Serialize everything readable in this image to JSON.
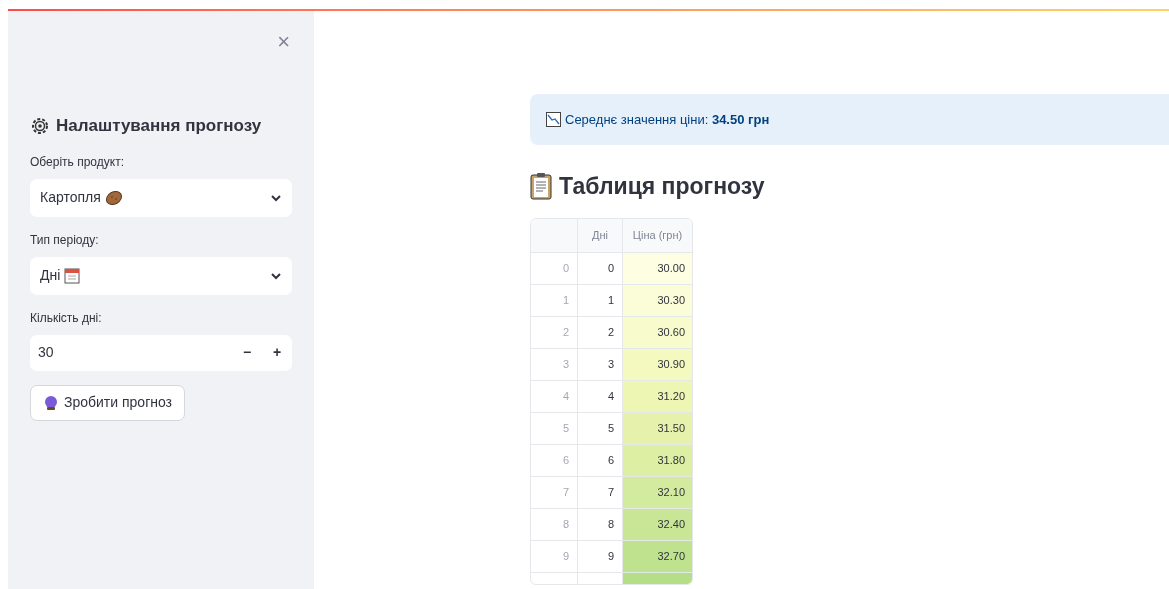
{
  "sidebar": {
    "close_label": "×",
    "title": "Налаштування прогнозу",
    "fields": [
      {
        "kind": "select",
        "label": "Оберіть продукт:",
        "value": "Картопля",
        "icon": {
          "kind": "potato"
        }
      },
      {
        "kind": "select",
        "label": "Тип періоду:",
        "value": "Дні",
        "icon": {
          "kind": "calendar"
        }
      },
      {
        "kind": "number",
        "label": "Кількість дні:",
        "value": "30",
        "minus": "−",
        "plus": "+"
      }
    ],
    "button": "Зробити прогноз"
  },
  "alert": {
    "text": "Середнє значення ціни: **34.50 грн**"
  },
  "table_title": "Таблиця прогнозу",
  "table": {
    "columns": [
      "Дні",
      "Ціна (грн)"
    ],
    "rows": [
      {
        "index": "0",
        "days": "0",
        "price": "30.00",
        "color": "#fefee3"
      },
      {
        "index": "1",
        "days": "1",
        "price": "30.30",
        "color": "#fbfcd8"
      },
      {
        "index": "2",
        "days": "2",
        "price": "30.60",
        "color": "#f8fbcc"
      },
      {
        "index": "3",
        "days": "3",
        "price": "30.90",
        "color": "#f4f9bf"
      },
      {
        "index": "4",
        "days": "4",
        "price": "31.20",
        "color": "#eef6b3"
      },
      {
        "index": "5",
        "days": "5",
        "price": "31.50",
        "color": "#e6f2ab"
      },
      {
        "index": "6",
        "days": "6",
        "price": "31.80",
        "color": "#dcefa3"
      },
      {
        "index": "7",
        "days": "7",
        "price": "32.10",
        "color": "#d3eb9e"
      },
      {
        "index": "8",
        "days": "8",
        "price": "32.40",
        "color": "#c9e697"
      },
      {
        "index": "9",
        "days": "9",
        "price": "32.70",
        "color": "#bfe28e"
      }
    ],
    "partial_row": {
      "color": "#b5de88"
    }
  }
}
